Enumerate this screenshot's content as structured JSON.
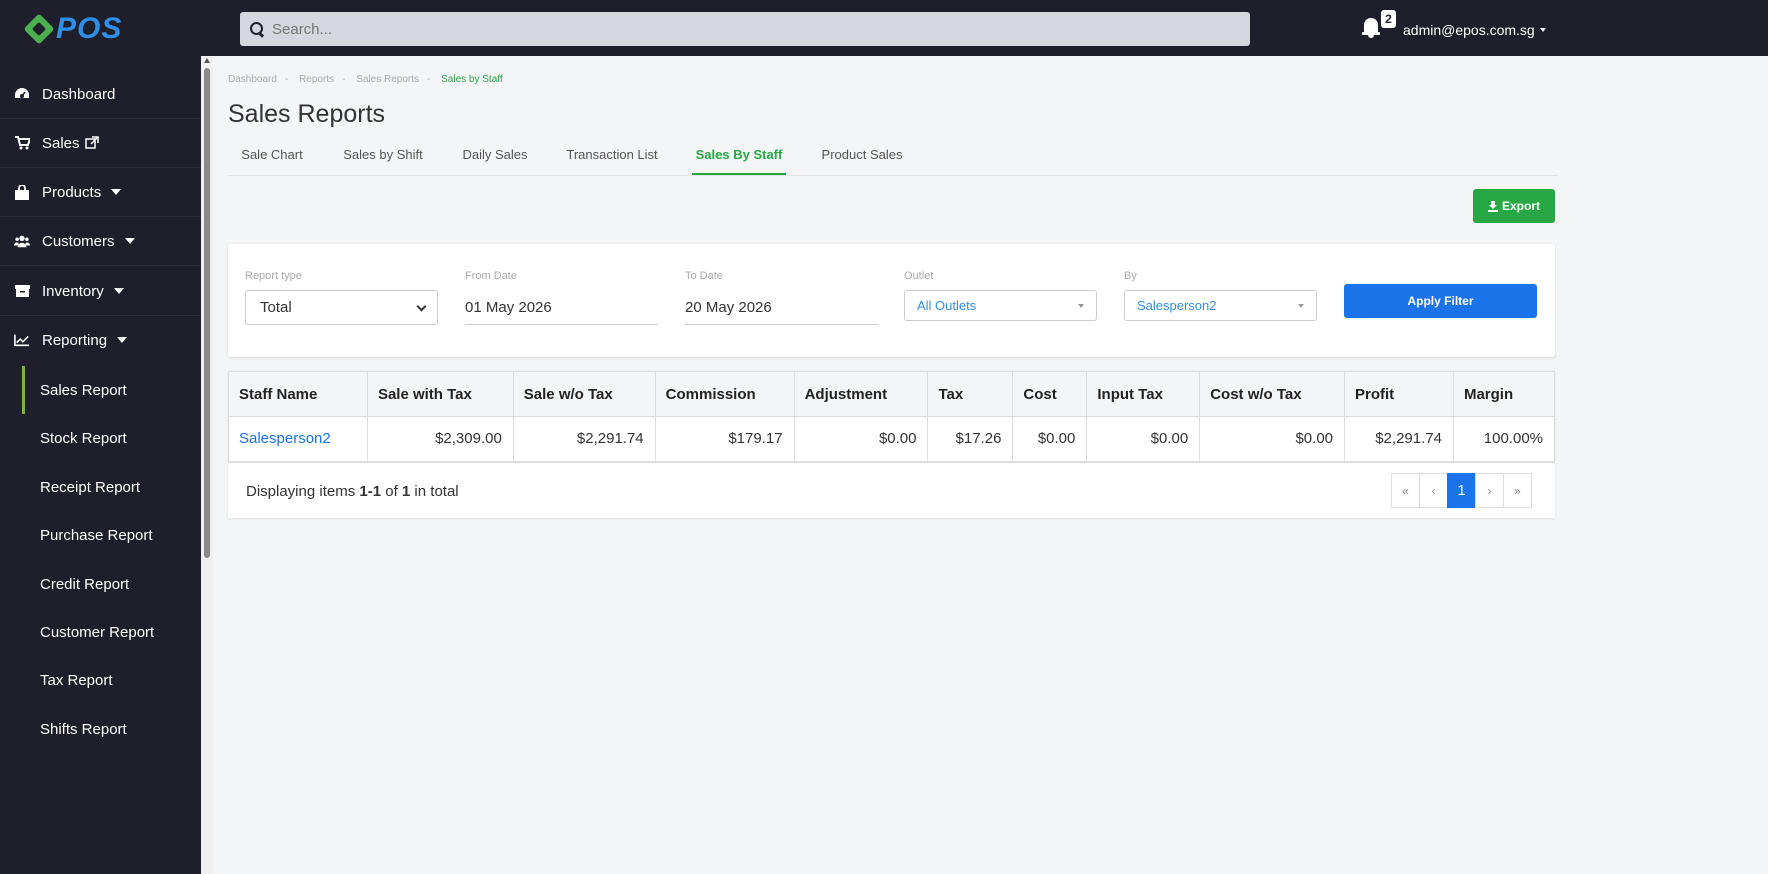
{
  "brand": {
    "logo_text": "POS",
    "logo_color": "#2f8fe8",
    "mark_color": "#4caf50"
  },
  "header": {
    "search_placeholder": "Search...",
    "notification_count": "2",
    "user_email": "admin@epos.com.sg"
  },
  "sidebar": {
    "items": [
      {
        "label": "Dashboard",
        "icon": "dashboard-icon"
      },
      {
        "label": "Sales",
        "icon": "cart-icon",
        "external_icon": "external-link-icon"
      },
      {
        "label": "Products",
        "icon": "bag-icon"
      },
      {
        "label": "Customers",
        "icon": "users-icon"
      },
      {
        "label": "Inventory",
        "icon": "box-icon"
      },
      {
        "label": "Reporting",
        "icon": "chart-line-icon"
      }
    ],
    "reporting_sub": [
      "Sales Report",
      "Stock Report",
      "Receipt Report",
      "Purchase Report",
      "Credit Report",
      "Customer Report",
      "Tax Report",
      "Shifts Report"
    ],
    "active_sub": "Sales Report"
  },
  "breadcrumb": [
    "Dashboard",
    "Reports",
    "Sales Reports",
    "Sales by Staff"
  ],
  "page_title": "Sales Reports",
  "tabs": [
    "Sale Chart",
    "Sales by Shift",
    "Daily Sales",
    "Transaction List",
    "Sales By Staff",
    "Product Sales"
  ],
  "active_tab": "Sales By Staff",
  "export_label": "Export",
  "filters": {
    "report_type_label": "Report type",
    "report_type_value": "Total",
    "from_label": "From Date",
    "from_value": "01 May 2026",
    "to_label": "To Date",
    "to_value": "20 May 2026",
    "outlet_label": "Outlet",
    "outlet_value": "All Outlets",
    "by_label": "By",
    "by_value": "Salesperson2",
    "apply_label": "Apply Filter"
  },
  "table": {
    "columns": [
      "Staff Name",
      "Sale with Tax",
      "Sale w/o Tax",
      "Commission",
      "Adjustment",
      "Tax",
      "Cost",
      "Input Tax",
      "Cost w/o Tax",
      "Profit",
      "Margin"
    ],
    "rows": [
      [
        "Salesperson2",
        "$2,309.00",
        "$2,291.74",
        "$179.17",
        "$0.00",
        "$17.26",
        "$0.00",
        "$0.00",
        "$0.00",
        "$2,291.74",
        "100.00%"
      ]
    ]
  },
  "summary": {
    "prefix": "Displaying items ",
    "range": "1-1",
    "of": " of ",
    "total": "1",
    "suffix": " in total"
  },
  "pagination": {
    "first": "«",
    "prev": "‹",
    "current": "1",
    "next": "›",
    "last": "»"
  },
  "colors": {
    "accent_green": "#28a745",
    "accent_blue": "#1a73e8",
    "sidebar_bg": "#1e1f2b"
  }
}
